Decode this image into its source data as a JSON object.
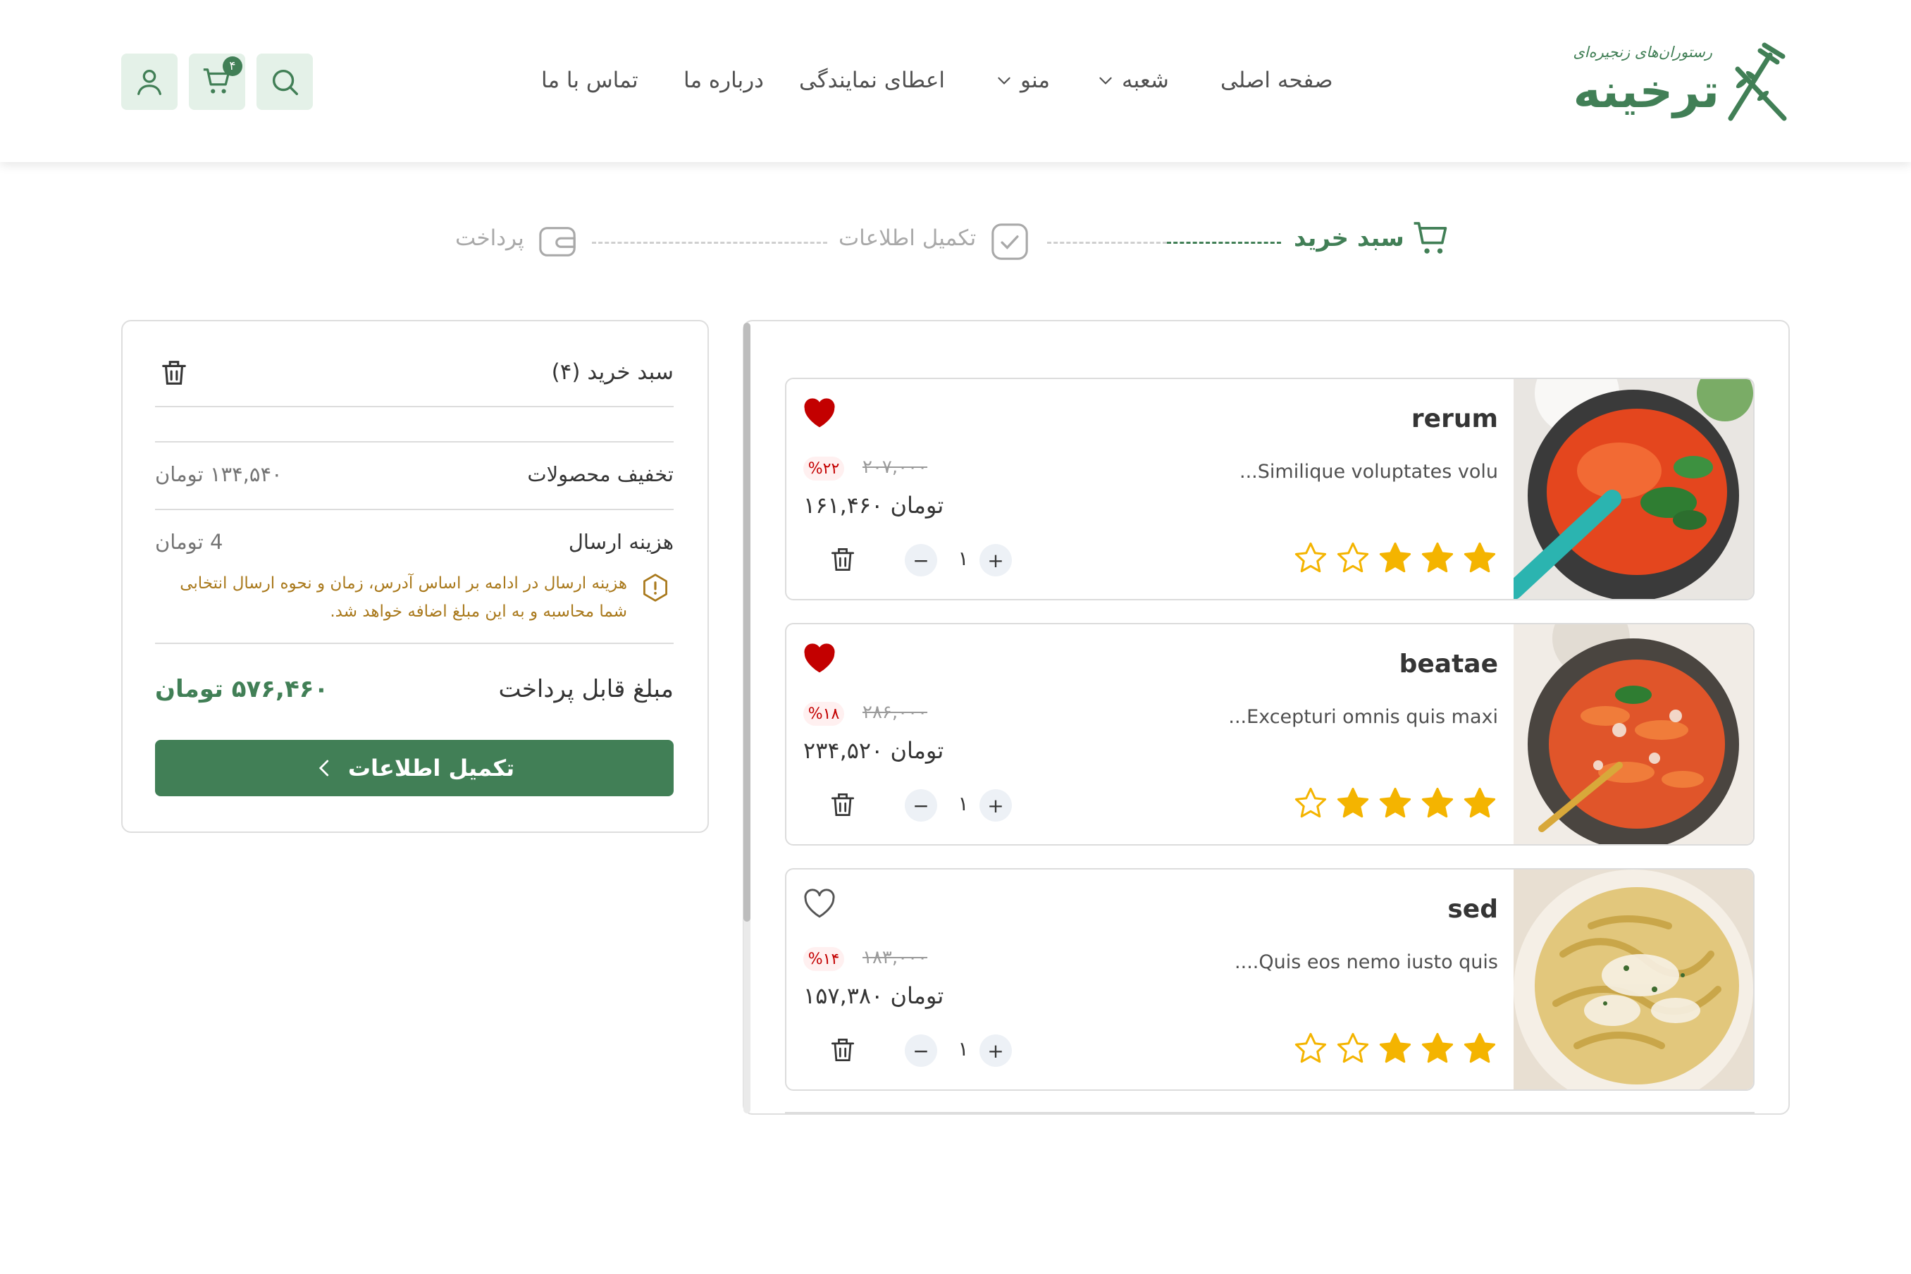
{
  "brand": {
    "subtitle": "رستوران‌های زنجیره‌ای",
    "name": "ترخینه"
  },
  "nav": {
    "home": "صفحه اصلی",
    "branch": "شعبه",
    "menu": "منو",
    "franchise": "اعطای نمایندگی",
    "about": "درباره ما",
    "contact": "تماس با ما"
  },
  "header_icons": {
    "search": "search-icon",
    "cart": "cart-icon",
    "cart_count": "۴",
    "user": "user-icon"
  },
  "steps": {
    "cart": "سبد خرید",
    "info": "تکمیل اطلاعات",
    "payment": "پرداخت"
  },
  "colors": {
    "brand": "#417F56",
    "brand_light": "#E4F1E8",
    "discount": "#C30000",
    "star": "#F4B400",
    "warning": "#A9791C"
  },
  "summary": {
    "title": "سبد خرید (۴)",
    "discount_label": "تخفیف محصولات",
    "discount_value": "۱۳۴,۵۴۰ تومان",
    "shipping_label": "هزینه ارسال",
    "shipping_value": "4 تومان",
    "shipping_note": "هزینه ارسال در ادامه بر اساس آدرس، زمان و نحوه ارسال انتخابی شما محاسبه و به این مبلغ اضافه خواهد شد.",
    "total_label": "مبلغ قابل پرداخت",
    "total_value": "۵۷۶,۴۶۰ تومان",
    "cta": "تکمیل اطلاعات"
  },
  "items": [
    {
      "name": "rerum",
      "desc": "...Similique voluptates volu",
      "discount": "%۲۲",
      "old_price": "۲۰۷,۰۰۰",
      "price": "۱۶۱,۴۶۰  تومان",
      "qty": "۱",
      "rating": 3,
      "favorite": true
    },
    {
      "name": "beatae",
      "desc": "...Excepturi omnis quis maxi",
      "discount": "%۱۸",
      "old_price": "۲۸۶,۰۰۰",
      "price": "۲۳۴,۵۲۰  تومان",
      "qty": "۱",
      "rating": 4,
      "favorite": true
    },
    {
      "name": "sed",
      "desc": "....Quis eos nemo iusto quis",
      "discount": "%۱۴",
      "old_price": "۱۸۳,۰۰۰",
      "price": "۱۵۷,۳۸۰  تومان",
      "qty": "۱",
      "rating": 3,
      "favorite": false
    }
  ]
}
